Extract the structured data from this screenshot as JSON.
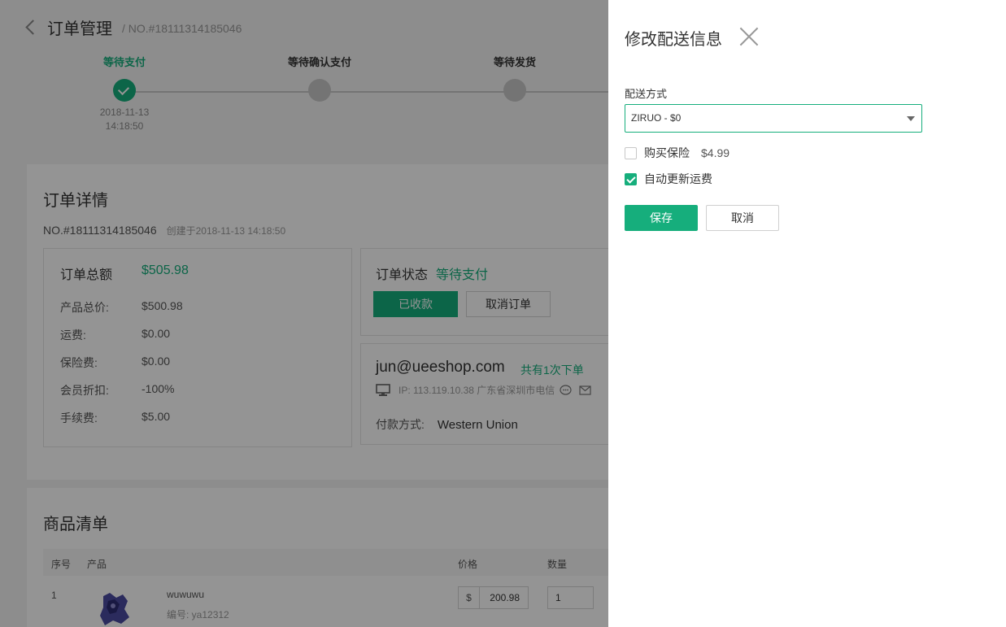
{
  "header": {
    "title": "订单管理",
    "order_no": "/ NO.#18111314185046"
  },
  "steps": [
    {
      "label": "等待支付",
      "time_date": "2018-11-13",
      "time_clock": "14:18:50",
      "done": true
    },
    {
      "label": "等待确认支付",
      "done": false
    },
    {
      "label": "等待发货",
      "done": false
    }
  ],
  "detail": {
    "title": "订单详情",
    "order_no": "NO.#18111314185046",
    "created": "创建于2018-11-13 14:18:50",
    "amounts": {
      "total_label": "订单总额",
      "total_value": "$505.98",
      "rows": [
        {
          "label": "产品总价:",
          "value": "$500.98"
        },
        {
          "label": "运费:",
          "value": "$0.00"
        },
        {
          "label": "保险费:",
          "value": "$0.00"
        },
        {
          "label": "会员折扣:",
          "value": "-100%"
        },
        {
          "label": "手续费:",
          "value": "$5.00"
        }
      ]
    },
    "status": {
      "label": "订单状态",
      "value": "等待支付",
      "received_button": "已收款",
      "cancel_button": "取消订单"
    },
    "customer": {
      "email": "jun@ueeshop.com",
      "orders": "共有1次下单",
      "ip": "IP: 113.119.10.38 广东省深圳市电信",
      "payment_label": "付款方式:",
      "payment_value": "Western Union"
    }
  },
  "products": {
    "title": "商品清单",
    "columns": {
      "index": "序号",
      "product": "产品",
      "price": "价格",
      "qty": "数量"
    },
    "rows": [
      {
        "index": "1",
        "name": "wuwuwu",
        "sku": "编号: ya12312",
        "currency": "$",
        "price": "200.98",
        "qty": "1"
      }
    ]
  },
  "drawer": {
    "title": "修改配送信息",
    "shipping_label": "配送方式",
    "shipping_value": "ZIRUO - $0",
    "insurance_label": "购买保险",
    "insurance_price": "$4.99",
    "insurance_checked": false,
    "auto_update_label": "自动更新运费",
    "auto_update_checked": true,
    "save_button": "保存",
    "cancel_button": "取消"
  },
  "colors": {
    "accent": "#16ae7c",
    "overlay": "rgba(0,0,0,0.42)"
  }
}
